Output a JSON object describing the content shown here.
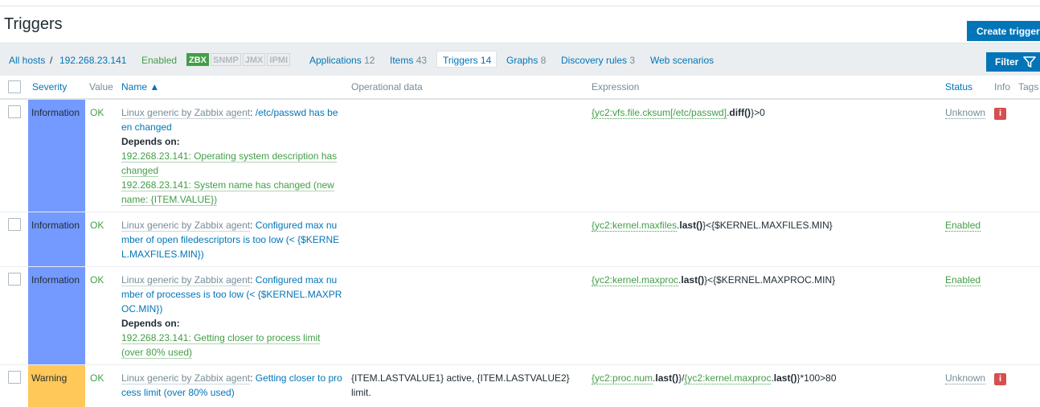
{
  "header": {
    "title": "Triggers",
    "create_label": "Create trigger"
  },
  "nav": {
    "all_hosts": "All hosts",
    "sep": "/",
    "host": "192.268.23.141",
    "enabled": "Enabled",
    "availability": [
      "ZBX",
      "SNMP",
      "JMX",
      "IPMI"
    ],
    "applications_label": "Applications",
    "applications_count": "12",
    "items_label": "Items",
    "items_count": "43",
    "triggers_label": "Triggers",
    "triggers_count": "14",
    "graphs_label": "Graphs",
    "graphs_count": "8",
    "discovery_label": "Discovery rules",
    "discovery_count": "3",
    "web_label": "Web scenarios",
    "filter_label": "Filter"
  },
  "columns": {
    "severity": "Severity",
    "value": "Value",
    "name": "Name ▲",
    "opdata": "Operational data",
    "expression": "Expression",
    "status": "Status",
    "info": "Info",
    "tags": "Tags"
  },
  "rows": [
    {
      "severity": "Information",
      "value": "OK",
      "template": "Linux generic by Zabbix agent",
      "name_a": "/etc/passwd has be",
      "name_b": "en changed",
      "depends_label": "Depends on:",
      "dep1_a": "192.268.23.141: Operating system description has",
      "dep1_b": "changed",
      "dep2_a": "192.268.23.141: System name has changed (new",
      "dep2_b": "name: {ITEM.VALUE})",
      "opdata": "",
      "expr_item": "{yc2:vfs.file.cksum[/etc/passwd]",
      "expr_dot": ".",
      "expr_fn": "diff()",
      "expr_rest": "}>0",
      "status": "Unknown",
      "info": "i"
    },
    {
      "severity": "Information",
      "value": "OK",
      "template": "Linux generic by Zabbix agent",
      "name_a": "Configured max nu",
      "name_b": "mber of open filedescriptors is too low (< {$KERNE",
      "name_c": "L.MAXFILES.MIN})",
      "expr_item": "{yc2:kernel.maxfiles",
      "expr_dot": ".",
      "expr_fn": "last()",
      "expr_rest": "}<{$KERNEL.MAXFILES.MIN}",
      "status": "Enabled"
    },
    {
      "severity": "Information",
      "value": "OK",
      "template": "Linux generic by Zabbix agent",
      "name_a": "Configured max nu",
      "name_b": "mber of processes is too low (< {$KERNEL.MAXPR",
      "name_c": "OC.MIN})",
      "depends_label": "Depends on:",
      "dep1_a": "192.268.23.141: Getting closer to process limit",
      "dep1_b": "(over 80% used)",
      "expr_item": "{yc2:kernel.maxproc",
      "expr_dot": ".",
      "expr_fn": "last()",
      "expr_rest": "}<{$KERNEL.MAXPROC.MIN}",
      "status": "Enabled"
    },
    {
      "severity": "Warning",
      "value": "OK",
      "template": "Linux generic by Zabbix agent",
      "name_a": "Getting closer to pro",
      "name_b": "cess limit (over 80% used)",
      "opdata_a": "{ITEM.LASTVALUE1} active, {ITEM.LASTVALUE2}",
      "opdata_b": "limit.",
      "expr_item": "{yc2:proc.num",
      "expr_dot": ".",
      "expr_fn": "last()",
      "expr_mid": "}/",
      "expr_item2": "{yc2:kernel.maxproc",
      "expr_dot2": ".",
      "expr_fn2": "last()",
      "expr_rest": "}*100>80",
      "status": "Unknown",
      "info": "i"
    }
  ],
  "colors": {
    "info_sev": "#7499ff",
    "warn_sev": "#ffc859",
    "accent": "#0275b8",
    "ok": "#429e47",
    "problem_icon": "#d64e4e"
  }
}
